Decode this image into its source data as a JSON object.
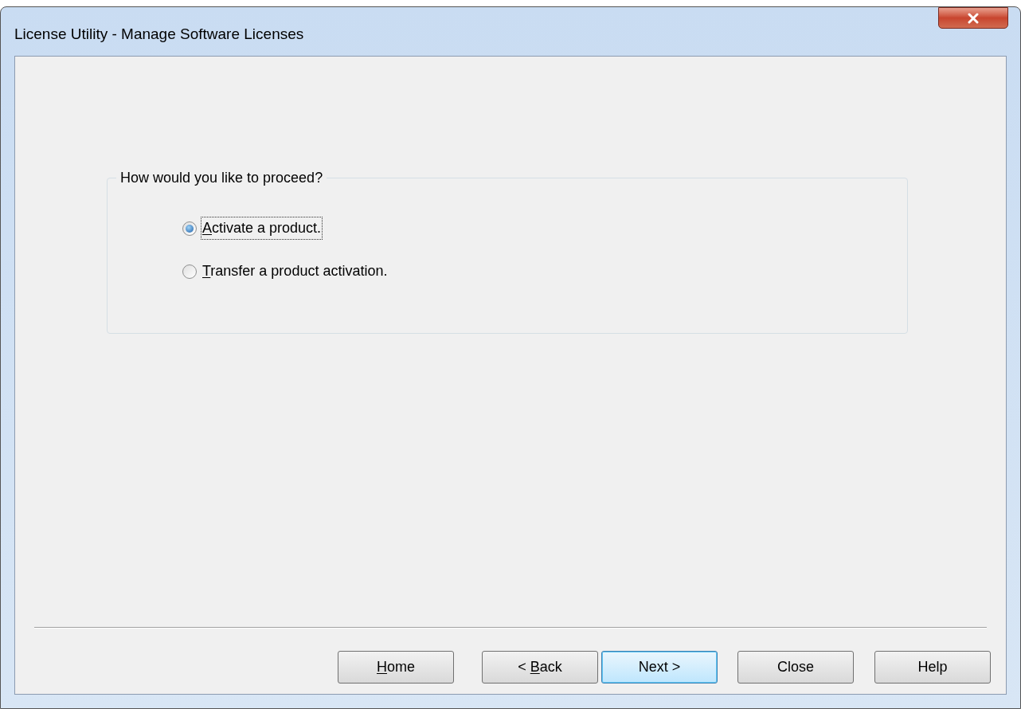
{
  "window": {
    "title": "License Utility - Manage Software Licenses"
  },
  "group": {
    "legend": "How would you like to proceed?",
    "options": [
      {
        "access_key": "A",
        "text_after": "ctivate a product.",
        "selected": true,
        "focused": true
      },
      {
        "access_key": "T",
        "text_after": "ransfer a product activation.",
        "selected": false,
        "focused": false
      }
    ]
  },
  "buttons": [
    {
      "access_key": "H",
      "text_after": "ome",
      "default": false
    },
    {
      "text_before": "< ",
      "access_key": "B",
      "text_after": "ack",
      "default": false
    },
    {
      "text_before": "Next >",
      "default": true
    },
    {
      "text_before": "Close",
      "default": false
    },
    {
      "text_before": "Help",
      "default": false
    }
  ]
}
